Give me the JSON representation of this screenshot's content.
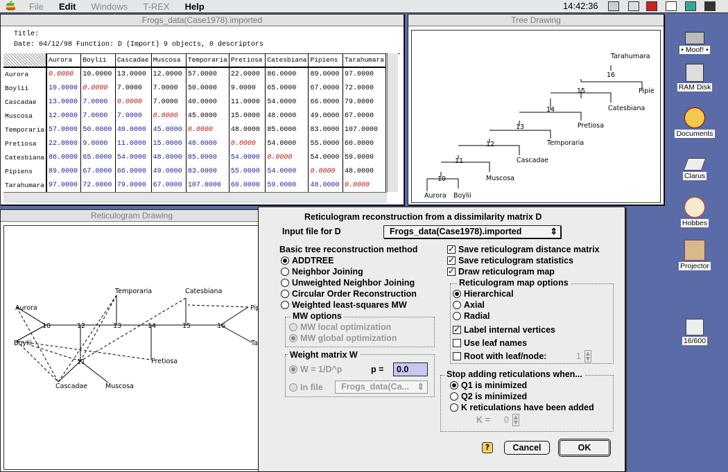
{
  "menubar": {
    "file": "File",
    "edit": "Edit",
    "windows": "Windows",
    "trex": "T-REX",
    "help": "Help",
    "clock": "14:42:36"
  },
  "matrix_window": {
    "title": "Frogs_data(Case1978).imported",
    "title_label": "Title:",
    "info": "Date: 04/12/98   Function: D (Import)        9 objects, 0 descriptors",
    "columns": [
      "Aurora",
      "Boylii",
      "Cascadae",
      "Muscosa",
      "Temporaria",
      "Pretiosa",
      "Catesbiana",
      "Pipiens",
      "Tarahumara"
    ],
    "rows": [
      {
        "name": "Aurora",
        "values": [
          "0.0000",
          "10.0000",
          "13.0000",
          "12.0000",
          "57.0000",
          "22.0000",
          "86.0000",
          "89.0000",
          "97.0000"
        ]
      },
      {
        "name": "Boylii",
        "values": [
          "10.0000",
          "0.0000",
          "7.0000",
          "7.0000",
          "50.0000",
          "9.0000",
          "65.0000",
          "67.0000",
          "72.0000"
        ]
      },
      {
        "name": "Cascadae",
        "values": [
          "13.0000",
          "7.0000",
          "0.0000",
          "7.0000",
          "40.0000",
          "11.0000",
          "54.0000",
          "66.0000",
          "79.0000"
        ]
      },
      {
        "name": "Muscosa",
        "values": [
          "12.0000",
          "7.0000",
          "7.0000",
          "0.0000",
          "45.0000",
          "15.0000",
          "48.0000",
          "49.0000",
          "67.0000"
        ]
      },
      {
        "name": "Temporaria",
        "values": [
          "57.0000",
          "50.0000",
          "40.0000",
          "45.0000",
          "0.0000",
          "48.0000",
          "85.0000",
          "83.0000",
          "107.0000"
        ]
      },
      {
        "name": "Pretiosa",
        "values": [
          "22.0000",
          "9.0000",
          "11.0000",
          "15.0000",
          "48.0000",
          "0.0000",
          "54.0000",
          "55.0000",
          "60.0000"
        ]
      },
      {
        "name": "Catesbiana",
        "values": [
          "86.0000",
          "65.0000",
          "54.0000",
          "48.0000",
          "85.0000",
          "54.0000",
          "0.0000",
          "54.0000",
          "59.0000"
        ]
      },
      {
        "name": "Pipiens",
        "values": [
          "89.0000",
          "67.0000",
          "66.0000",
          "49.0000",
          "83.0000",
          "55.0000",
          "54.0000",
          "0.0000",
          "48.0000"
        ]
      },
      {
        "name": "Tarahumara",
        "values": [
          "97.0000",
          "72.0000",
          "79.0000",
          "67.0000",
          "107.0000",
          "60.0000",
          "59.0000",
          "48.0000",
          "0.0000"
        ]
      }
    ]
  },
  "tree_window": {
    "title": "Tree Drawing",
    "leaves": [
      "Tarahumara",
      "Pipie",
      "Catesbiana",
      "Pretiosa",
      "Temporaria",
      "Cascadae",
      "Muscosa",
      "Aurora",
      "Boylii"
    ],
    "nodes": [
      "16",
      "15",
      "14",
      "13",
      "12",
      "11",
      "10"
    ]
  },
  "reticulogram_window": {
    "title": "Reticulogram Drawing",
    "leaves": [
      "Aurora",
      "Boylii",
      "Cascadae",
      "Muscosa",
      "Temporaria",
      "Catesbiana",
      "Pretiosa",
      "Pip",
      "Ta"
    ],
    "nodes": [
      "10",
      "12",
      "13",
      "14",
      "15",
      "16",
      "11"
    ]
  },
  "dialog": {
    "title": "Reticulogram reconstruction from a dissimilarity matrix D",
    "input_label": "Input file for D",
    "input_value": "Frogs_data(Case1978).imported",
    "method_label": "Basic tree reconstruction method",
    "methods": [
      "ADDTREE",
      "Neighbor Joining",
      "Unweighted Neighbor Joining",
      "Circular Order Reconstruction",
      "Weighted least-squares MW"
    ],
    "mw_options_label": "MW options",
    "mw_options": [
      "MW local optimization",
      "MW global optimization"
    ],
    "weight_label": "Weight matrix W",
    "weight_formula": "W = 1/D^p",
    "p_label": "p =",
    "p_value": "0.0",
    "in_file_label": "In file",
    "in_file_value": "Frogs_data(Ca...",
    "save_matrix": "Save reticulogram distance matrix",
    "save_stats": "Save reticulogram statistics",
    "draw_map": "Draw reticulogram map",
    "map_options_label": "Reticulogram map options",
    "map_options": [
      "Hierarchical",
      "Axial",
      "Radial"
    ],
    "label_internal": "Label internal vertices",
    "use_leaf_names": "Use leaf names",
    "root_with": "Root with leaf/node:",
    "root_value": "1",
    "stop_label": "Stop adding reticulations when...",
    "stop_options": [
      "Q1 is minimized",
      "Q2 is minimized",
      "K reticulations have been added"
    ],
    "k_label": "K =",
    "k_value": "0",
    "help": "?",
    "cancel": "Cancel",
    "ok": "OK"
  },
  "desktop": {
    "icons": [
      "• Moof! •",
      "RAM Disk",
      "Documents",
      "Clarus",
      "Hobbes",
      "Projector",
      "16/600"
    ]
  }
}
